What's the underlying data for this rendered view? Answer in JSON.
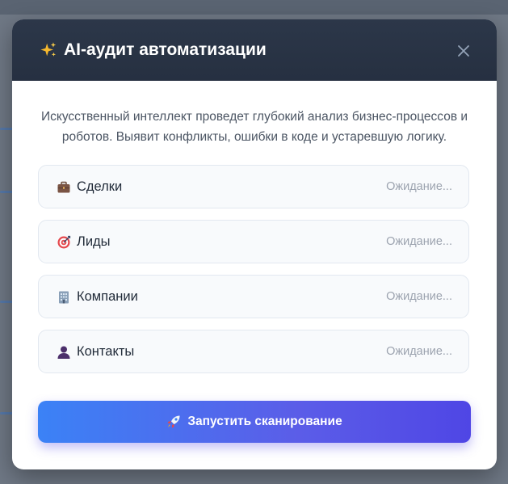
{
  "modal": {
    "title": "AI-аудит автоматизации",
    "title_icon": "sparkles-icon",
    "close_icon": "close-icon",
    "description": "Искусственный интеллект проведет глубокий анализ бизнес-процессов и роботов. Выявит конфликты, ошибки в коде и устаревшую логику.",
    "entities": [
      {
        "label": "Сделки",
        "icon": "briefcase-icon",
        "status": "Ожидание..."
      },
      {
        "label": "Лиды",
        "icon": "target-icon",
        "status": "Ожидание..."
      },
      {
        "label": "Компании",
        "icon": "building-icon",
        "status": "Ожидание..."
      },
      {
        "label": "Контакты",
        "icon": "person-icon",
        "status": "Ожидание..."
      }
    ],
    "scan_button": {
      "label": "Запустить сканирование",
      "icon": "rocket-icon"
    }
  },
  "colors": {
    "header_bg": "#263041",
    "button_gradient_start": "#3b82f6",
    "button_gradient_end": "#4f46e5",
    "status_text": "#9ca3af"
  }
}
